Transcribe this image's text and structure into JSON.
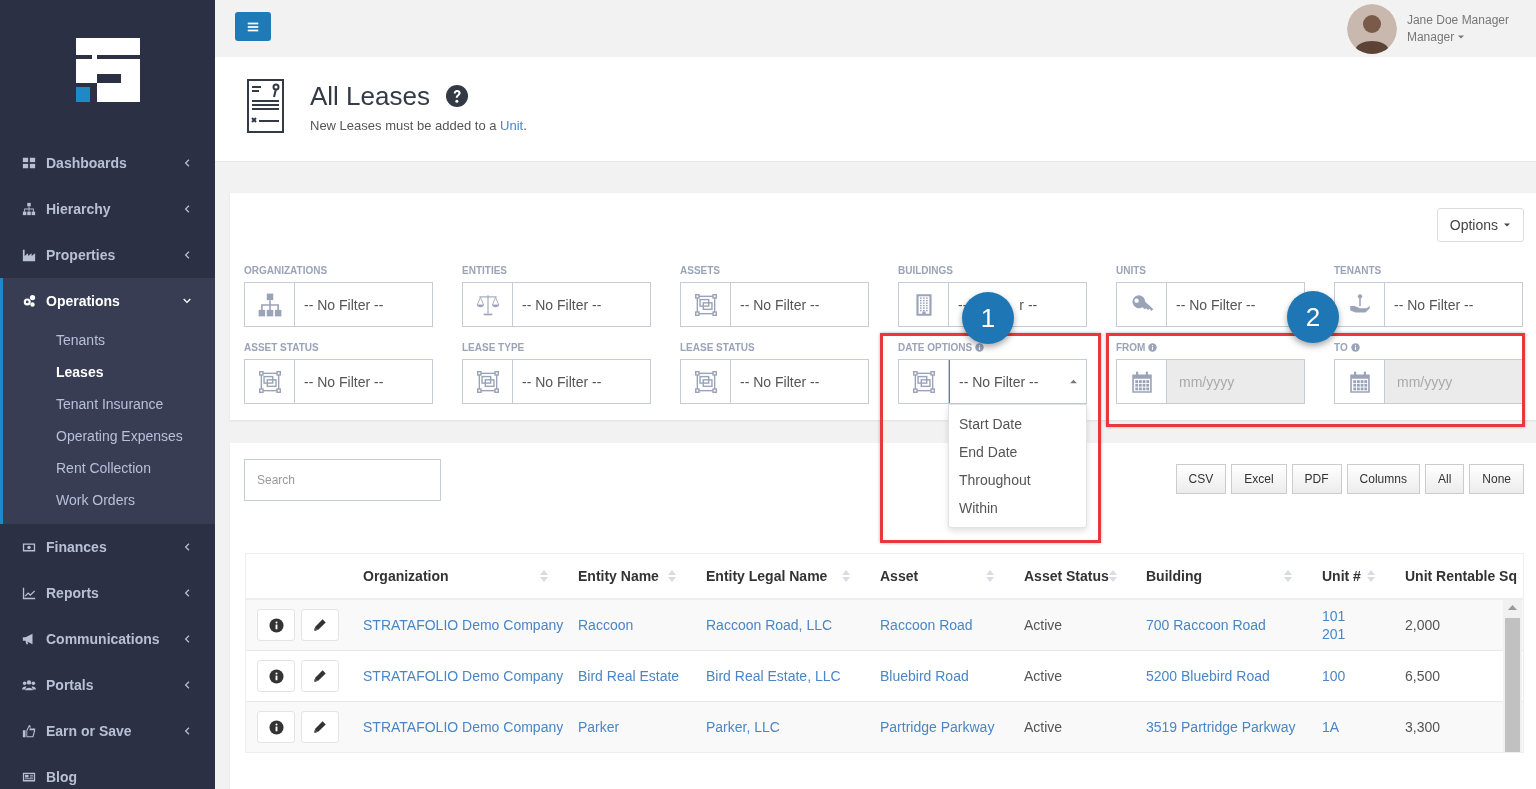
{
  "sidebar": {
    "items": [
      {
        "label": "Dashboards",
        "kind": "group",
        "expanded": false
      },
      {
        "label": "Hierarchy",
        "kind": "group",
        "expanded": false
      },
      {
        "label": "Properties",
        "kind": "group",
        "expanded": false
      },
      {
        "label": "Operations",
        "kind": "group",
        "expanded": true,
        "children": [
          {
            "label": "Tenants",
            "selected": false
          },
          {
            "label": "Leases",
            "selected": true
          },
          {
            "label": "Tenant Insurance",
            "selected": false
          },
          {
            "label": "Operating Expenses",
            "selected": false
          },
          {
            "label": "Rent Collection",
            "selected": false
          },
          {
            "label": "Work Orders",
            "selected": false
          }
        ]
      },
      {
        "label": "Finances",
        "kind": "group",
        "expanded": false
      },
      {
        "label": "Reports",
        "kind": "group",
        "expanded": false
      },
      {
        "label": "Communications",
        "kind": "group",
        "expanded": false
      },
      {
        "label": "Portals",
        "kind": "group",
        "expanded": false
      },
      {
        "label": "Earn or Save",
        "kind": "group",
        "expanded": false
      },
      {
        "label": "Blog",
        "kind": "link"
      }
    ]
  },
  "topbar": {
    "user_name": "Jane Doe Manager",
    "user_role": "Manager"
  },
  "page_header": {
    "title": "All Leases",
    "subtitle_before": "New Leases must be added to a",
    "subtitle_link": "Unit",
    "subtitle_after": "."
  },
  "filters": {
    "options_button": "Options",
    "fields": [
      {
        "label": "ORGANIZATIONS",
        "kind": "select",
        "value": "-- No Filter --",
        "info": false,
        "expanded": false
      },
      {
        "label": "ENTITIES",
        "kind": "select",
        "value": "-- No Filter --",
        "info": false,
        "expanded": false
      },
      {
        "label": "ASSETS",
        "kind": "select",
        "value": "-- No Filter --",
        "info": false,
        "expanded": false
      },
      {
        "label": "BUILDINGS",
        "kind": "select",
        "value_parts": [
          "--",
          "r --"
        ],
        "info": false,
        "expanded": false
      },
      {
        "label": "UNITS",
        "kind": "select",
        "value": "-- No Filter --",
        "info": false,
        "expanded": false
      },
      {
        "label": "TENANTS",
        "kind": "select",
        "value": "-- No Filter --",
        "info": false,
        "expanded": false
      },
      {
        "label": "ASSET STATUS",
        "kind": "select",
        "value": "-- No Filter --",
        "info": false,
        "expanded": false
      },
      {
        "label": "LEASE TYPE",
        "kind": "select",
        "value": "-- No Filter --",
        "info": false,
        "expanded": false
      },
      {
        "label": "LEASE STATUS",
        "kind": "select",
        "value": "-- No Filter --",
        "info": false,
        "expanded": false
      },
      {
        "label": "DATE OPTIONS",
        "kind": "select",
        "value": "-- No Filter --",
        "info": true,
        "expanded": true,
        "options": [
          "Start Date",
          "End Date",
          "Throughout",
          "Within"
        ]
      },
      {
        "label": "FROM",
        "kind": "date",
        "placeholder": "mm/yyyy",
        "info": true,
        "disabled": true
      },
      {
        "label": "TO",
        "kind": "date",
        "placeholder": "mm/yyyy",
        "info": true,
        "disabled": true
      }
    ]
  },
  "annotations": [
    {
      "number": "1"
    },
    {
      "number": "2"
    }
  ],
  "table": {
    "search": {
      "placeholder": "Search"
    },
    "export_buttons": [
      "CSV",
      "Excel",
      "PDF",
      "Columns",
      "All",
      "None"
    ],
    "columns": [
      {
        "label": "Organization",
        "sortable": true,
        "link": true
      },
      {
        "label": "Entity Name",
        "sortable": true,
        "link": true
      },
      {
        "label": "Entity Legal Name",
        "sortable": true,
        "link": true
      },
      {
        "label": "Asset",
        "sortable": true,
        "link": true
      },
      {
        "label": "Asset Status",
        "sortable": true,
        "link": false
      },
      {
        "label": "Building",
        "sortable": true,
        "link": true
      },
      {
        "label": "Unit #",
        "sortable": true,
        "link": true
      },
      {
        "label": "Unit Rentable Sq",
        "sortable": false,
        "link": false
      }
    ],
    "rows": [
      {
        "cells": [
          "STRATAFOLIO Demo Company",
          "Raccoon",
          "Raccoon Road, LLC",
          "Raccoon Road",
          "Active",
          "700 Raccoon Road",
          "101\n201",
          "2,000"
        ]
      },
      {
        "cells": [
          "STRATAFOLIO Demo Company",
          "Bird Real Estate",
          "Bird Real Estate, LLC",
          "Bluebird Road",
          "Active",
          "5200 Bluebird Road",
          "100",
          "6,500"
        ]
      },
      {
        "cells": [
          "STRATAFOLIO Demo Company",
          "Parker",
          "Parker, LLC",
          "Partridge Parkway",
          "Active",
          "3519 Partridge Parkway",
          "1A",
          "3,300"
        ]
      }
    ]
  }
}
